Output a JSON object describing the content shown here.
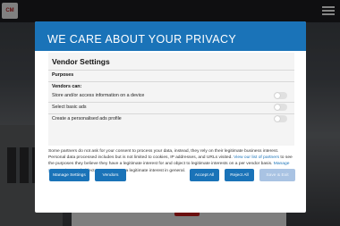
{
  "site": {
    "logo_text": "CM",
    "icons": {
      "menu": "hamburger-icon"
    }
  },
  "modal": {
    "title": "WE CARE ABOUT YOUR PRIVACY",
    "accent_color": "#1a73b8",
    "vendor_settings": {
      "heading": "Vendor Settings",
      "purposes_heading": "Purposes",
      "vendors_can": "Vendors can:",
      "items": [
        {
          "label": "Store and/or access information on a device",
          "enabled": false
        },
        {
          "label": "Select basic ads",
          "enabled": false
        },
        {
          "label": "Create a personalised ads profile",
          "enabled": false
        }
      ]
    },
    "body": {
      "part1": "Some partners do not ask for your consent to process your data, instead, they rely on their legitimate business interest. Personal data processed includes but is not limited to cookies, IP addresses, and URLs visited. ",
      "link1": "View our list of partners",
      "part2": " to see the purposes they believe they have a legitimate interest for and object to legitimate interests on a per vendor basis. ",
      "link2": "Manage your settings",
      "part3": " and object to purposes as a legitimate interest in general."
    },
    "buttons": {
      "manage_settings": "Manage Settings",
      "vendors": "Vendors",
      "accept_all": "Accept All",
      "reject_all": "Reject All",
      "save_exit": "Save & Exit"
    }
  }
}
